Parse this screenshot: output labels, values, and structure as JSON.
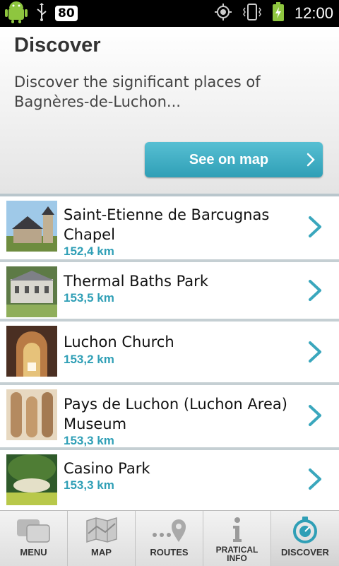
{
  "status_bar": {
    "notification_icons": [
      "android-icon",
      "usb-icon"
    ],
    "battery_level": "80",
    "system_icons": [
      "gps-icon",
      "vibrate-icon",
      "charging-battery-icon"
    ],
    "time": "12:00"
  },
  "header": {
    "title": "Discover",
    "description": "Discover the significant places of Bagnères-de-Luchon...",
    "map_button_label": "See on map"
  },
  "places": [
    {
      "name": "Saint-Etienne de Barcugnas Chapel",
      "distance": "152,4 km"
    },
    {
      "name": "Thermal Baths Park",
      "distance": "153,5 km"
    },
    {
      "name": "Luchon Church",
      "distance": "153,2 km"
    },
    {
      "name": "Pays de Luchon (Luchon Area) Museum",
      "distance": "153,3 km"
    },
    {
      "name": "Casino Park",
      "distance": "153,3 km"
    }
  ],
  "tabs": [
    {
      "label": "MENU",
      "icon": "menu-icon"
    },
    {
      "label": "MAP",
      "icon": "map-icon"
    },
    {
      "label": "ROUTES",
      "icon": "routes-icon"
    },
    {
      "label": "PRATICAL INFO",
      "icon": "info-icon"
    },
    {
      "label": "DISCOVER",
      "icon": "discover-icon",
      "active": true
    }
  ],
  "colors": {
    "accent": "#2f9fb6",
    "button_top": "#57bfd3",
    "divider": "#c5cfd3"
  }
}
